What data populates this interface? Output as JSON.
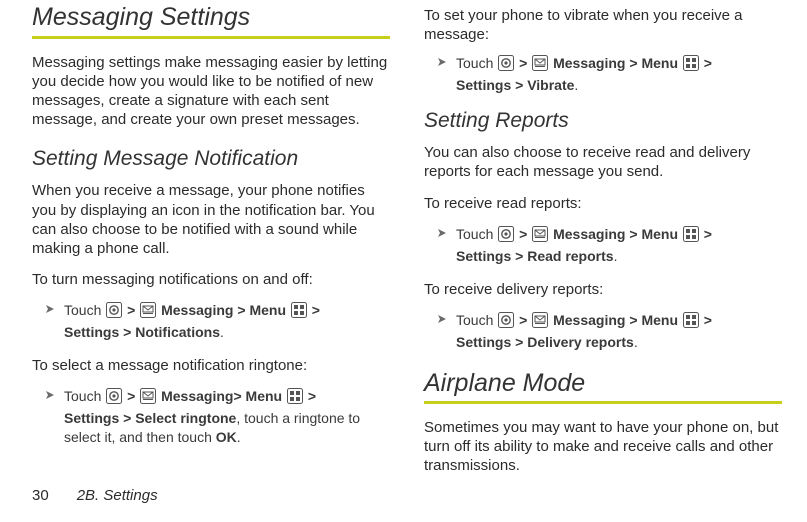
{
  "left": {
    "h1": "Messaging Settings",
    "intro": "Messaging settings make messaging easier by letting you decide how you would like to be notified of new messages, create a signature with each sent message, and create your own preset messages.",
    "h2": "Setting Message Notification",
    "sub_intro": "When you receive a message, your phone notifies you by displaying an icon in the notification bar. You can also choose to be notified with a sound while making a phone call.",
    "lead1": "To turn messaging notifications on and off:",
    "step1": {
      "touch": "Touch",
      "gt1": ">",
      "msg": "Messaging",
      "gt2": ">",
      "menu": "Menu",
      "gt3": ">",
      "settings": "Settings",
      "gt4": ">",
      "leaf": "Notifications",
      "dot": "."
    },
    "lead2": "To select a message notification ringtone:",
    "step2": {
      "touch": "Touch",
      "gt1": ">",
      "msg": "Messaging",
      "gt2": ">",
      "menu": "Menu",
      "gt3": ">",
      "settings": "Settings",
      "gt4": ">",
      "leaf": "Select ringtone",
      "tail1": ", touch a ringtone to select it, and then touch ",
      "ok": "OK",
      "dot": "."
    }
  },
  "right": {
    "lead1": "To set your phone to vibrate when you receive a message:",
    "step1": {
      "touch": "Touch",
      "gt1": ">",
      "msg": "Messaging",
      "gt2": ">",
      "menu": "Menu",
      "gt3": ">",
      "settings": "Settings",
      "gt4": ">",
      "leaf": "Vibrate",
      "dot": "."
    },
    "h2a": "Setting Reports",
    "intro_a": "You can also choose to receive read and delivery reports for each message you send.",
    "lead2": "To receive read reports:",
    "step2": {
      "touch": "Touch",
      "gt1": ">",
      "msg": "Messaging",
      "gt2": ">",
      "menu": "Menu",
      "gt3": ">",
      "settings": "Settings",
      "gt4": ">",
      "leaf": "Read reports",
      "dot": "."
    },
    "lead3": "To receive delivery reports:",
    "step3": {
      "touch": "Touch",
      "gt1": ">",
      "msg": "Messaging",
      "gt2": ">",
      "menu": "Menu",
      "gt3": ">",
      "settings": "Settings",
      "gt4": ">",
      "leaf": "Delivery reports",
      "dot": "."
    },
    "h1b": "Airplane Mode",
    "intro_b": "Sometimes you may want to have your phone on, but turn off its ability to make and receive calls and other transmissions."
  },
  "footer": {
    "page_number": "30",
    "section": "2B. Settings"
  }
}
